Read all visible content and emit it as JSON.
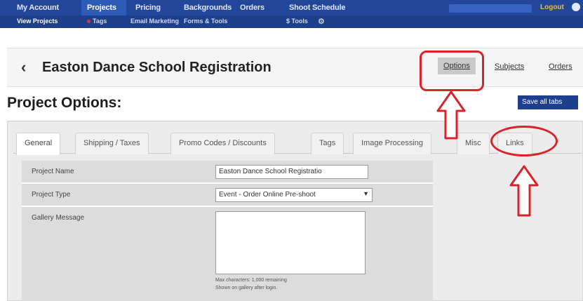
{
  "topnav": {
    "items": [
      "My Account",
      "Projects",
      "Pricing",
      "Backgrounds",
      "Orders",
      "Shoot Schedule"
    ],
    "subitems": [
      "View Projects",
      "Tags",
      "Email Marketing",
      "Forms & Tools",
      "$ Tools"
    ],
    "logout": "Logout"
  },
  "header": {
    "back": "‹",
    "title": "Easton Dance School Registration",
    "links": [
      "Options",
      "Subjects",
      "Orders"
    ]
  },
  "section": {
    "title": "Project Options:",
    "save_label": "Save all tabs"
  },
  "tabs": [
    "General",
    "Shipping / Taxes",
    "Promo Codes / Discounts",
    "Tags",
    "Image Processing",
    "Misc",
    "Links"
  ],
  "form": {
    "name_label": "Project Name",
    "name_value": "Easton Dance School Registratio",
    "type_label": "Project Type",
    "type_value": "Event - Order Online Pre-shoot",
    "gallery_label": "Gallery Message",
    "char_note_1": "Max characters: 1,000 remaining",
    "char_note_2": "Shown on gallery after login."
  },
  "colors": {
    "nav_bg": "#22479a",
    "annotation": "#d8232a"
  }
}
